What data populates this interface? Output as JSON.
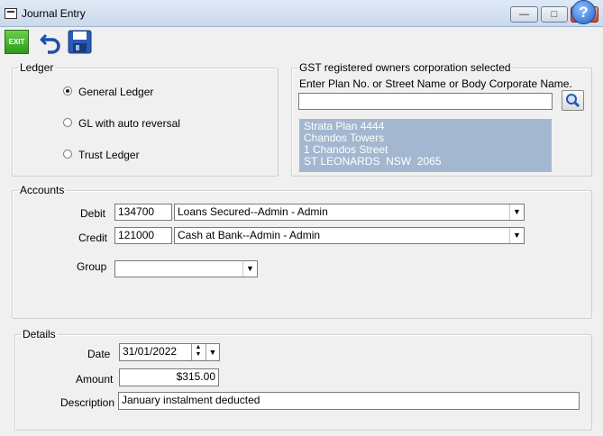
{
  "window": {
    "title": "Journal Entry",
    "min_glyph": "—",
    "max_glyph": "□",
    "close_glyph": "✕"
  },
  "toolbar": {
    "exit_label": "EXIT",
    "help_glyph": "?"
  },
  "ledger": {
    "legend": "Ledger",
    "options": [
      {
        "label": "General Ledger",
        "selected": true
      },
      {
        "label": "GL with auto reversal",
        "selected": false
      },
      {
        "label": "Trust Ledger",
        "selected": false
      }
    ]
  },
  "gst": {
    "legend": "GST registered owners corporation selected",
    "prompt": "Enter Plan No. or Street Name or Body Corporate Name.",
    "search_value": "",
    "selected_lines": [
      "Strata Plan 4444",
      "Chandos Towers",
      "1 Chandos Street",
      "ST LEONARDS  NSW  2065"
    ]
  },
  "accounts": {
    "legend": "Accounts",
    "debit": {
      "label": "Debit",
      "code": "134700",
      "name": "Loans Secured--Admin - Admin"
    },
    "credit": {
      "label": "Credit",
      "code": "121000",
      "name": "Cash at Bank--Admin - Admin"
    },
    "group": {
      "label": "Group",
      "value": ""
    }
  },
  "details": {
    "legend": "Details",
    "date_label": "Date",
    "date_value": "31/01/2022",
    "amount_label": "Amount",
    "amount_value": "$315.00",
    "description_label": "Description",
    "description_value": "January instalment deducted"
  },
  "icons": {
    "exit": "exit-icon",
    "undo": "undo-icon",
    "save": "save-icon",
    "help": "help-icon",
    "search": "magnifier-icon"
  },
  "colors": {
    "selection_bg": "#a3b7d1",
    "exit_green": "#2d9a1a",
    "help_blue": "#1f5fc9"
  }
}
